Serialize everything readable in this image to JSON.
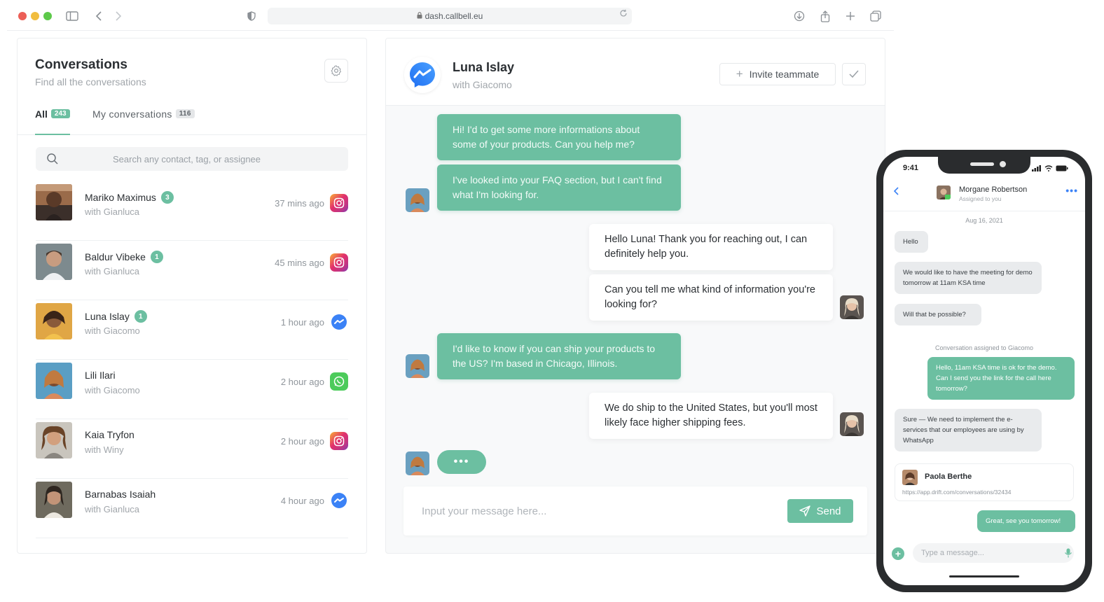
{
  "browser": {
    "url": "dash.callbell.eu"
  },
  "conversations": {
    "title": "Conversations",
    "subtitle": "Find all the conversations",
    "tabs": [
      {
        "label": "All",
        "count": "243"
      },
      {
        "label": "My conversations",
        "count": "116"
      }
    ],
    "search_placeholder": "Search any contact, tag, or assignee",
    "items": [
      {
        "name": "Mariko Maximus",
        "count": "3",
        "with": "with Gianluca",
        "time": "37 mins ago",
        "channel": "instagram-icon"
      },
      {
        "name": "Baldur Vibeke",
        "count": "1",
        "with": "with Gianluca",
        "time": "45 mins ago",
        "channel": "instagram-icon"
      },
      {
        "name": "Luna Islay",
        "count": "1",
        "with": "with Giacomo",
        "time": "1 hour ago",
        "channel": "messenger-icon"
      },
      {
        "name": "Lili Ilari",
        "count": "",
        "with": "with Giacomo",
        "time": "2 hour ago",
        "channel": "whatsapp-icon"
      },
      {
        "name": "Kaia Tryfon",
        "count": "",
        "with": "with Winy",
        "time": "2 hour ago",
        "channel": "instagram-icon"
      },
      {
        "name": "Barnabas Isaiah",
        "count": "",
        "with": "with Gianluca",
        "time": "4 hour ago",
        "channel": "messenger-icon"
      }
    ]
  },
  "chat": {
    "name": "Luna Islay",
    "with": "with Giacomo",
    "invite_label": "Invite teammate",
    "messages": [
      {
        "from": "contact",
        "text": "Hi! I'd to get some more informations about some of your products. Can you help me?"
      },
      {
        "from": "contact",
        "text": "I've looked into your FAQ section, but I can't find what I'm looking for."
      },
      {
        "from": "agent",
        "text": "Hello Luna! Thank you for reaching out, I can definitely help you."
      },
      {
        "from": "agent",
        "text": "Can you tell me what kind of information you're looking for?"
      },
      {
        "from": "contact",
        "text": "I'd like to know if you can ship your products to the US? I'm based in Chicago, Illinois."
      },
      {
        "from": "agent",
        "text": "We do ship to the United States, but you'll most likely face higher shipping fees."
      }
    ],
    "typing_indicator": "•••",
    "input_placeholder": "Input your message here...",
    "send_label": "Send"
  },
  "phone": {
    "status_time": "9:41",
    "contact_name": "Morgane Robertson",
    "contact_status": "Assigned to you",
    "date": "Aug 16, 2021",
    "messages": [
      {
        "from": "contact",
        "text": "Hello"
      },
      {
        "from": "contact",
        "text": "We would like to have the meeting for demo tomorrow at 11am KSA time"
      },
      {
        "from": "contact",
        "text": "Will that be possible?"
      },
      {
        "from": "agent",
        "text": "Hello, 11am KSA time is ok for the demo. Can I send you the link for the call here tomorrow?"
      },
      {
        "from": "contact",
        "text": "Sure — We need to implement the e-services that our employees are using by WhatsApp"
      },
      {
        "from": "agent",
        "text": "Great, see you tomorrow!"
      }
    ],
    "note": "Conversation assigned to Giacomo",
    "card": {
      "name": "Paola Berthe",
      "link": "https://app.drift.com/conversations/32434"
    },
    "input_placeholder": "Type a message..."
  },
  "colors": {
    "accent": "#6cbfa1",
    "messenger": "#3b82f6",
    "whatsapp": "#4ccb5b"
  }
}
